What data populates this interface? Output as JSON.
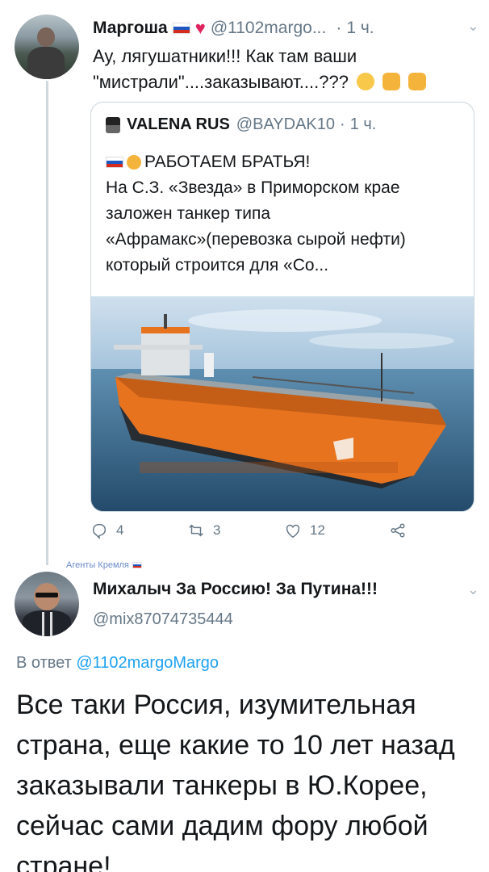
{
  "tweet1": {
    "author_name": "Маргоша",
    "handle": "@1102margo...",
    "time": "1 ч.",
    "text": "Ау, лягушатники!!! Как там ваши \"мистрали\"....заказывают....???"
  },
  "quoted": {
    "author_name": "VALENA RUS",
    "handle": "@BAYDAK10",
    "time": "1 ч.",
    "title": "РАБОТАЕМ БРАТЬЯ!",
    "text": "На С.З. «Звезда» в Приморском крае заложен танкер типа «Афрамакс»(перевозка сырой нефти) который строится для «Со..."
  },
  "actions": {
    "replies": "4",
    "retweets": "3",
    "likes": "12"
  },
  "agent_label": "Агенты Кремля",
  "tweet2": {
    "author_name": "Михалыч За Россию! За Путина!!!",
    "handle": "@mix87074735444",
    "reply_prefix": "В ответ",
    "reply_handle": "@1102margoMargo",
    "text": "Все таки Россия, изумительная страна, еще какие то 10 лет назад заказывали танкеры в Ю.Корее, сейчас сами дадим фору любой стране!"
  },
  "colors": {
    "link": "#1da1f2",
    "secondary_text": "#657786",
    "heart": "#e0245e",
    "hull_orange": "#e8731f"
  },
  "icons": [
    "chevron-down-icon",
    "reply-icon",
    "retweet-icon",
    "like-icon",
    "share-icon",
    "russian-flag-icon",
    "heart-icon"
  ]
}
